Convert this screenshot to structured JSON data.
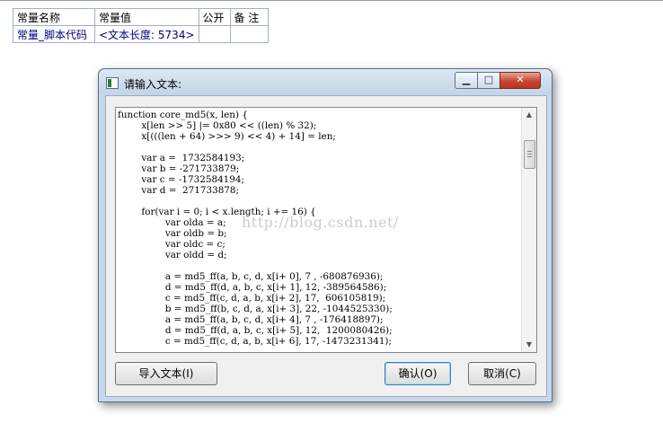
{
  "table": {
    "headers": [
      "常量名称",
      "常量值",
      "公开",
      "备 注"
    ],
    "rows": [
      {
        "name": "常量_脚本代码",
        "value": "<文本长度: 5734>",
        "public": "",
        "note": ""
      }
    ]
  },
  "dialog": {
    "title": "请输入文本:",
    "controls": {
      "minimize": "▁",
      "maximize": "□",
      "close": "✕"
    },
    "code_text": "function core_md5(x, len) {\n        x[len >> 5] |= 0x80 << ((len) % 32);\n        x[(((len + 64) >>> 9) << 4) + 14] = len;\n\n        var a =  1732584193;\n        var b = -271733879;\n        var c = -1732584194;\n        var d =  271733878;\n\n        for(var i = 0; i < x.length; i += 16) {\n                var olda = a;\n                var oldb = b;\n                var oldc = c;\n                var oldd = d;\n\n                a = md5_ff(a, b, c, d, x[i+ 0], 7 , -680876936);\n                d = md5_ff(d, a, b, c, x[i+ 1], 12, -389564586);\n                c = md5_ff(c, d, a, b, x[i+ 2], 17,  606105819);\n                b = md5_ff(b, c, d, a, x[i+ 3], 22, -1044525330);\n                a = md5_ff(a, b, c, d, x[i+ 4], 7 , -176418897);\n                d = md5_ff(d, a, b, c, x[i+ 5], 12,  1200080426);\n                c = md5_ff(c, d, a, b, x[i+ 6], 17, -1473231341);",
    "watermark": "http://blog.csdn.net/",
    "buttons": {
      "import": "导入文本(I)",
      "ok": "确认(O)",
      "cancel": "取消(C)"
    }
  },
  "colors": {
    "table_value_text": "#0b7c8c",
    "table_row_text": "#000080",
    "close_button": "#c9452f"
  }
}
